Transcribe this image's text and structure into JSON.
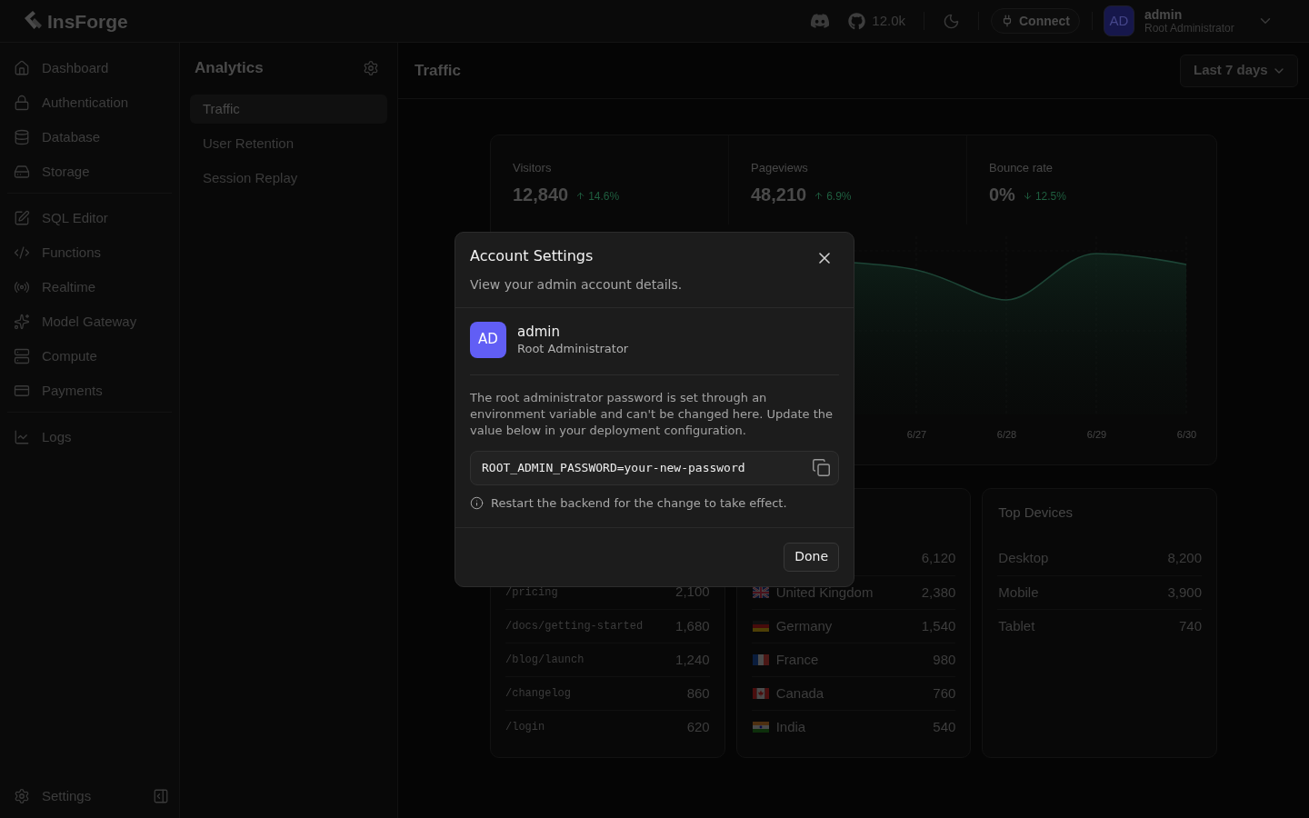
{
  "topbar": {
    "logo_text": "InsForge",
    "github_stars": "12.0k",
    "connect_button": "Connect",
    "user": {
      "initials": "AD",
      "name": "admin",
      "role": "Root Administrator"
    }
  },
  "sidebar": {
    "groups": [
      {
        "items": [
          {
            "label": "Dashboard"
          },
          {
            "label": "Authentication"
          },
          {
            "label": "Database"
          },
          {
            "label": "Storage"
          }
        ]
      },
      {
        "items": [
          {
            "label": "SQL Editor"
          },
          {
            "label": "Functions"
          },
          {
            "label": "Realtime"
          },
          {
            "label": "Model Gateway"
          },
          {
            "label": "Compute"
          },
          {
            "label": "Payments"
          }
        ]
      },
      {
        "items": [
          {
            "label": "Logs"
          }
        ]
      }
    ],
    "settings": "Settings"
  },
  "analytics_panel": {
    "title": "Analytics",
    "items": [
      {
        "label": "Traffic",
        "selected": true
      },
      {
        "label": "User Retention",
        "selected": false
      },
      {
        "label": "Session Replay",
        "selected": false
      }
    ]
  },
  "main": {
    "title": "Traffic",
    "range": "Last 7 days",
    "stats": [
      {
        "label": "Visitors",
        "value": "12,840",
        "change": "14.6%",
        "up": true
      },
      {
        "label": "Pageviews",
        "value": "48,210",
        "change": "6.9%",
        "up": true
      },
      {
        "label": "Bounce rate",
        "value": "0%",
        "change": "12.5%",
        "up": false
      }
    ],
    "chart": {
      "x_labels": [
        "6/27",
        "6/28",
        "6/29",
        "6/30"
      ]
    },
    "top_pages": {
      "rows": [
        {
          "path": "/pricing",
          "count": "2,100"
        },
        {
          "path": "/docs/getting-started",
          "count": "1,680"
        },
        {
          "path": "/blog/launch",
          "count": "1,240"
        },
        {
          "path": "/changelog",
          "count": "860"
        },
        {
          "path": "/login",
          "count": "620"
        }
      ]
    },
    "top_countries": {
      "rows": [
        {
          "count": "6,120"
        },
        {
          "kind": "uk",
          "name": "United Kingdom",
          "count": "2,380"
        },
        {
          "kind": "germany",
          "name": "Germany",
          "count": "1,540"
        },
        {
          "kind": "france",
          "name": "France",
          "count": "980"
        },
        {
          "kind": "canada",
          "name": "Canada",
          "count": "760"
        },
        {
          "kind": "india",
          "name": "India",
          "count": "540"
        }
      ]
    },
    "top_devices": {
      "title": "Top Devices",
      "rows": [
        {
          "name": "Desktop",
          "count": "8,200"
        },
        {
          "name": "Mobile",
          "count": "3,900"
        },
        {
          "name": "Tablet",
          "count": "740"
        }
      ]
    }
  },
  "modal": {
    "title": "Account Settings",
    "subtitle": "View your admin account details.",
    "user": {
      "initials": "AD",
      "name": "admin",
      "role": "Root Administrator"
    },
    "note": "The root administrator password is set through an environment variable and can't be changed here. Update the value below in your deployment configuration.",
    "code": "ROOT_ADMIN_PASSWORD=your-new-password",
    "hint": "Restart the backend for the change to take effect.",
    "done_button": "Done"
  }
}
